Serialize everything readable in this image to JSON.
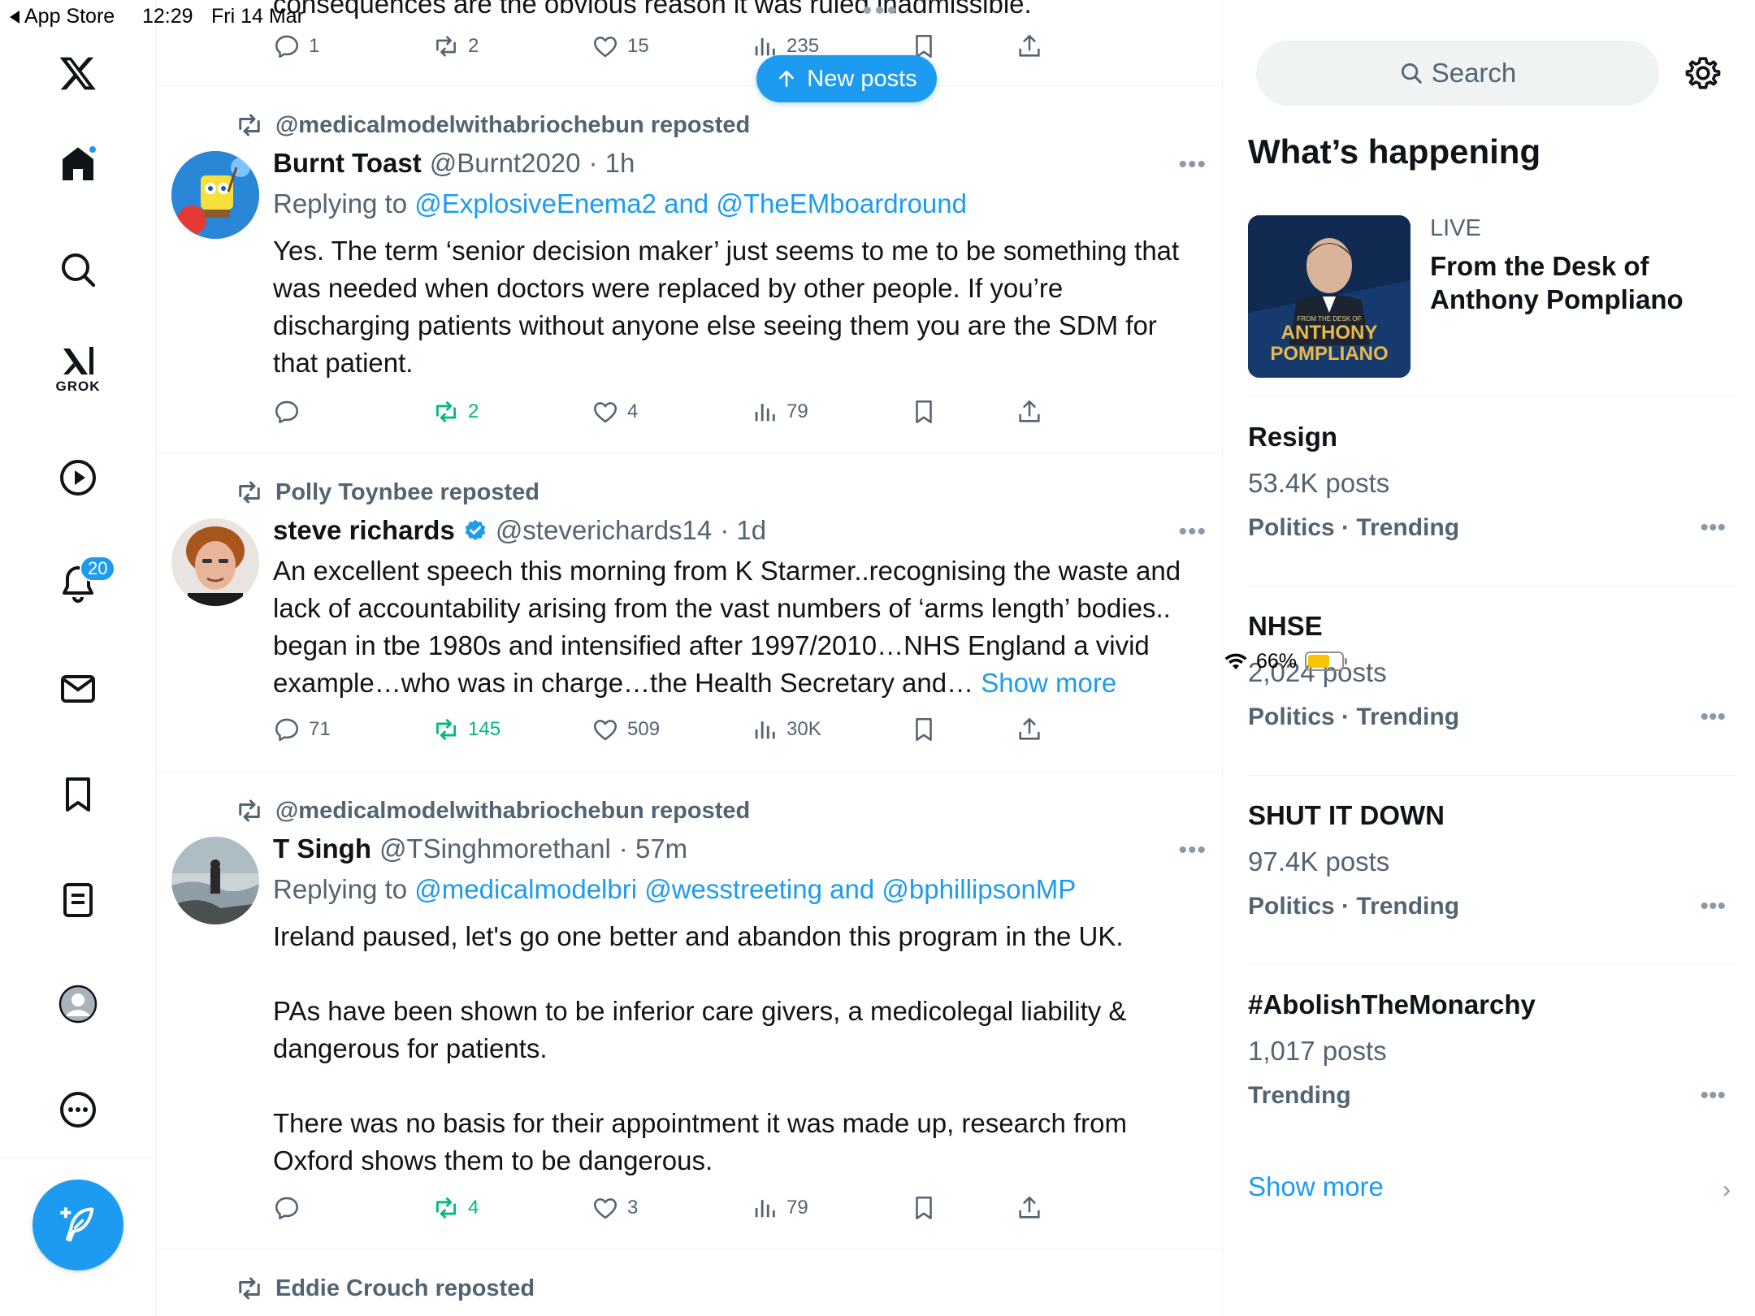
{
  "status_bar": {
    "back_label": "App Store",
    "time": "12:29",
    "date": "Fri 14 Mar",
    "battery": "66%"
  },
  "nav": {
    "grok_label": "GROK",
    "notifications_count": "20"
  },
  "top_post": {
    "partial_text": "consequences are the obvious reason it was ruled inadmissible.",
    "replies": "1",
    "reposts": "2",
    "likes": "15",
    "views": "235"
  },
  "new_posts_label": "New posts",
  "posts": [
    {
      "reposted_by": "@medicalmodelwithabriochebun reposted",
      "name": "Burnt Toast",
      "handle": "@Burnt2020",
      "time": "· 1h",
      "replying_prefix": "Replying to",
      "replying_to": "@ExplosiveEnema2 and @TheEMboardround",
      "body": "Yes. The term ‘senior decision maker’ just seems to me to be something that was needed when doctors were replaced by other people. If you’re discharging patients without anyone else seeing them you are the SDM for that patient.",
      "replies": "",
      "reposts": "2",
      "likes": "4",
      "views": "79"
    },
    {
      "reposted_by": "Polly Toynbee reposted",
      "name": "steve richards",
      "handle": "@steverichards14",
      "time": "· 1d",
      "body": "An excellent speech this morning from K Starmer..recognising the waste and lack of accountability arising from the vast numbers of ‘arms length’ bodies.. began in tbe 1980s and intensified after 1997/2010…NHS England a vivid example…who was in charge…the Health Secretary and…",
      "show_more": "Show more",
      "replies": "71",
      "reposts": "145",
      "likes": "509",
      "views": "30K"
    },
    {
      "reposted_by": "@medicalmodelwithabriochebun reposted",
      "name": "T Singh",
      "handle": "@TSinghmorethanl",
      "time": "· 57m",
      "replying_prefix": "Replying to",
      "replying_to": "@medicalmodelbri @wesstreeting and @bphillipsonMP",
      "body": "Ireland paused, let's go one better and abandon this program in the UK.\n\nPAs have been shown to be inferior care givers, a medicolegal liability & dangerous for patients.\n\nThere was no basis for their appointment it was made up, research from Oxford shows them to be dangerous.",
      "replies": "",
      "reposts": "4",
      "likes": "3",
      "views": "79"
    },
    {
      "reposted_by": "Eddie Crouch reposted"
    }
  ],
  "sidebar": {
    "search_placeholder": "Search",
    "section_title": "What’s happening",
    "live": {
      "label": "LIVE",
      "title": "From the Desk of Anthony Pompliano",
      "thumb_small": "FROM THE DESK OF",
      "thumb_line1": "ANTHONY",
      "thumb_line2": "POMPLIANO"
    },
    "trends": [
      {
        "name": "Resign",
        "count": "53.4K posts",
        "category": "Politics · Trending"
      },
      {
        "name": "NHSE",
        "count": "2,024 posts",
        "category": "Politics · Trending"
      },
      {
        "name": "SHUT IT DOWN",
        "count": "97.4K posts",
        "category": "Politics · Trending"
      },
      {
        "name": "#AbolishTheMonarchy",
        "count": "1,017 posts",
        "category": "Trending"
      }
    ],
    "show_more": "Show more"
  },
  "colors": {
    "accent": "#1d9bf0",
    "repost_green": "#00ba7c",
    "muted": "#536471"
  }
}
